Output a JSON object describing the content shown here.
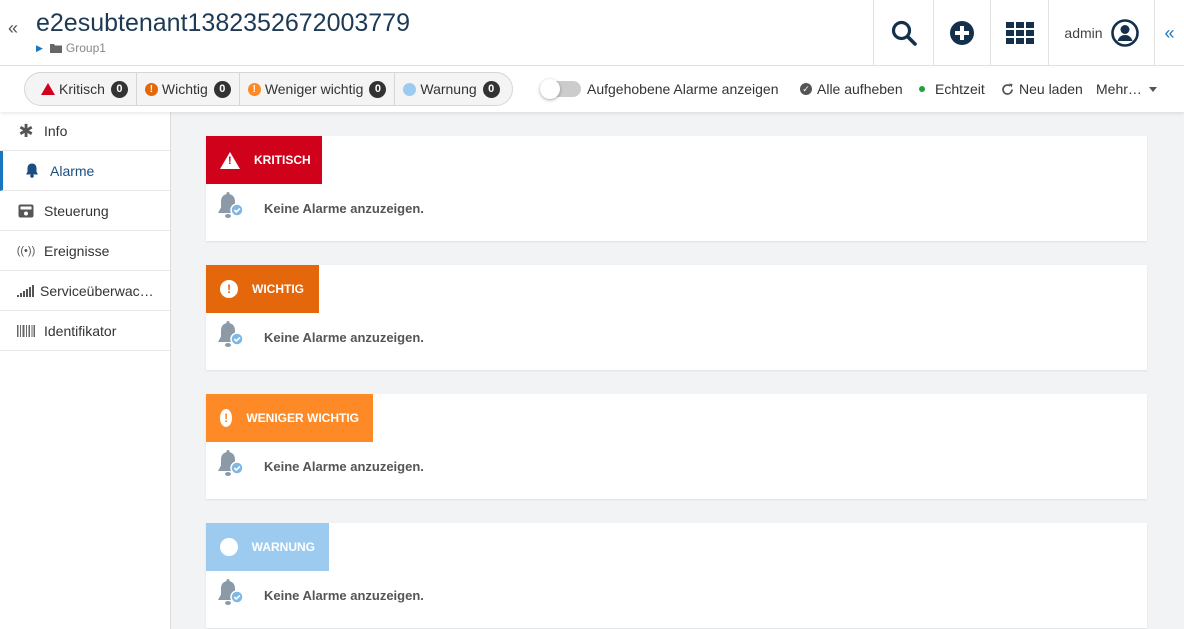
{
  "header": {
    "title": "e2esubtenant1382352672003779",
    "breadcrumb": "Group1",
    "user": "admin"
  },
  "toolbar": {
    "filters": [
      {
        "label": "Kritisch",
        "count": "0"
      },
      {
        "label": "Wichtig",
        "count": "0"
      },
      {
        "label": "Weniger wichtig",
        "count": "0"
      },
      {
        "label": "Warnung",
        "count": "0"
      }
    ],
    "toggle_label": "Aufgehobene Alarme anzeigen",
    "clear_all": "Alle aufheben",
    "realtime": "Echtzeit",
    "reload": "Neu laden",
    "more": "Mehr…"
  },
  "sidebar": {
    "items": [
      {
        "label": "Info"
      },
      {
        "label": "Alarme"
      },
      {
        "label": "Steuerung"
      },
      {
        "label": "Ereignisse"
      },
      {
        "label": "Serviceüberwac…"
      },
      {
        "label": "Identifikator"
      }
    ]
  },
  "sections": [
    {
      "label": "KRITISCH",
      "color": "#d0021b",
      "empty_text": "Keine Alarme anzuzeigen."
    },
    {
      "label": "WICHTIG",
      "color": "#e4670c",
      "empty_text": "Keine Alarme anzuzeigen."
    },
    {
      "label": "WENIGER WICHTIG",
      "color": "#fd8a26",
      "empty_text": "Keine Alarme anzuzeigen."
    },
    {
      "label": "WARNUNG",
      "color": "#9dcbf0",
      "empty_text": "Keine Alarme anzuzeigen."
    }
  ],
  "colors": {
    "accent": "#1776bf",
    "realtime_dot": "#1fa23a"
  }
}
